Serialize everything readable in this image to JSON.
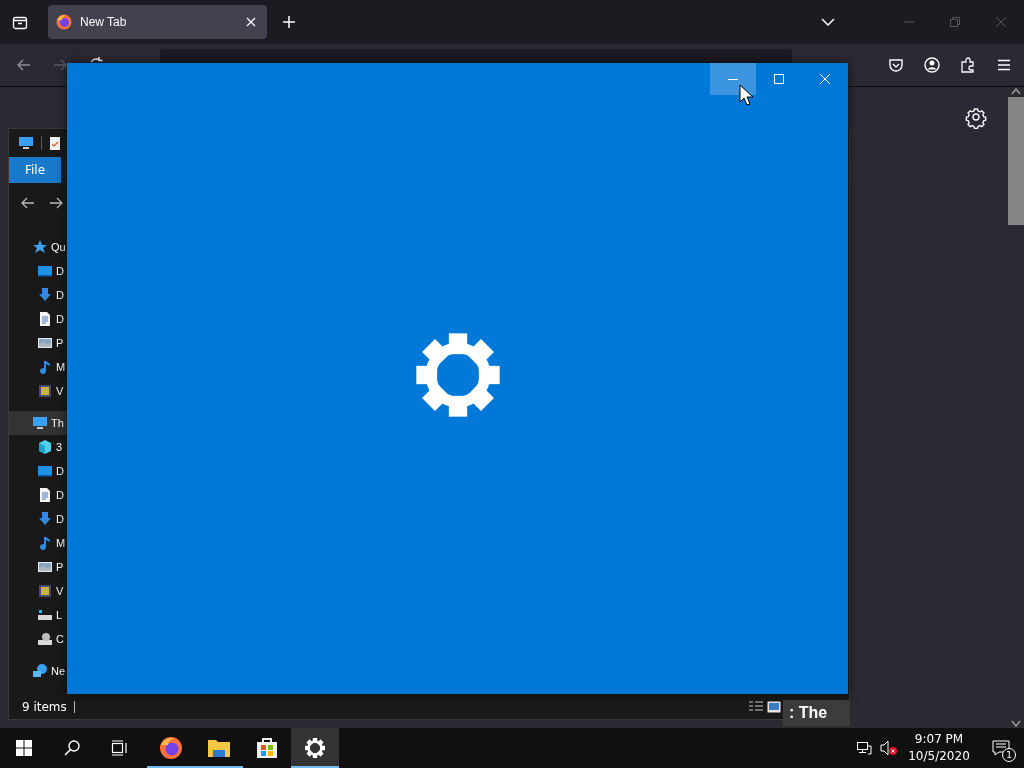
{
  "browser": {
    "tabs": [
      {
        "label": "New Tab",
        "selected": true
      }
    ]
  },
  "explorer": {
    "ribbon_tabs": [
      {
        "label": "File",
        "selected": true
      }
    ],
    "tree": [
      {
        "label": "Qu",
        "kind": "star",
        "selected": false,
        "children": [
          {
            "label": "D",
            "kind": "desktop",
            "selected": false
          },
          {
            "label": "D",
            "kind": "download",
            "selected": false
          },
          {
            "label": "D",
            "kind": "document",
            "selected": false
          },
          {
            "label": "P",
            "kind": "picture",
            "selected": false
          },
          {
            "label": "M",
            "kind": "music",
            "selected": false
          },
          {
            "label": "V",
            "kind": "video",
            "selected": false
          }
        ]
      },
      {
        "label": "Th",
        "kind": "computer",
        "selected": true,
        "children": [
          {
            "label": "3",
            "kind": "cube",
            "selected": false
          },
          {
            "label": "D",
            "kind": "desktop",
            "selected": false
          },
          {
            "label": "D",
            "kind": "document",
            "selected": false
          },
          {
            "label": "D",
            "kind": "download",
            "selected": false
          },
          {
            "label": "M",
            "kind": "music",
            "selected": false
          },
          {
            "label": "P",
            "kind": "picture",
            "selected": false
          },
          {
            "label": "V",
            "kind": "video",
            "selected": false
          },
          {
            "label": "L",
            "kind": "drive",
            "selected": false
          },
          {
            "label": "C",
            "kind": "disc",
            "selected": false
          }
        ]
      },
      {
        "label": "Ne",
        "kind": "network",
        "selected": false
      }
    ],
    "status": "9 items"
  },
  "behind_text": ": The",
  "settings_window": {
    "caption_buttons": [
      {
        "kind": "minimize",
        "hovered": true
      },
      {
        "kind": "maximize",
        "hovered": false
      },
      {
        "kind": "close",
        "hovered": false
      }
    ]
  },
  "taskbar": {
    "apps": [
      {
        "kind": "firefox",
        "running": true,
        "selected": false
      },
      {
        "kind": "explorer",
        "running": true,
        "selected": false
      },
      {
        "kind": "store",
        "running": false,
        "selected": false
      },
      {
        "kind": "settings",
        "running": true,
        "selected": true
      }
    ],
    "clock": {
      "time": "9:07 PM",
      "date": "10/5/2020"
    },
    "notifications": "1"
  }
}
